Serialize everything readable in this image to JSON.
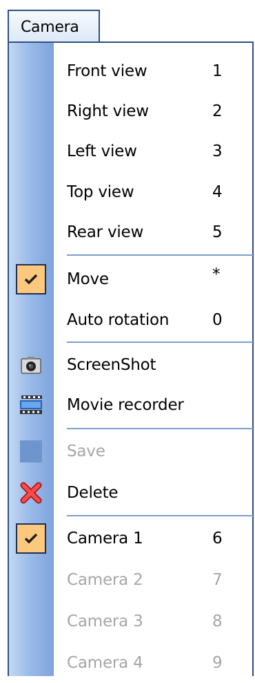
{
  "menubar": {
    "title": "Camera"
  },
  "menu": {
    "views": [
      {
        "label": "Front view",
        "shortcut": "1"
      },
      {
        "label": "Right view",
        "shortcut": "2"
      },
      {
        "label": "Left view",
        "shortcut": "3"
      },
      {
        "label": "Top view",
        "shortcut": "4"
      },
      {
        "label": "Rear view",
        "shortcut": "5"
      }
    ],
    "motion": [
      {
        "label": "Move",
        "shortcut": "*",
        "checked": true
      },
      {
        "label": "Auto rotation",
        "shortcut": "0",
        "checked": false
      }
    ],
    "capture": [
      {
        "label": "ScreenShot",
        "icon": "camera-icon"
      },
      {
        "label": "Movie recorder",
        "icon": "film-icon"
      }
    ],
    "file": [
      {
        "label": "Save",
        "icon": "save-icon",
        "disabled": true
      },
      {
        "label": "Delete",
        "icon": "delete-icon",
        "disabled": false
      }
    ],
    "cameras": [
      {
        "label": "Camera 1",
        "shortcut": "6",
        "checked": true,
        "disabled": false
      },
      {
        "label": "Camera 2",
        "shortcut": "7",
        "checked": false,
        "disabled": true
      },
      {
        "label": "Camera 3",
        "shortcut": "8",
        "checked": false,
        "disabled": true
      },
      {
        "label": "Camera 4",
        "shortcut": "9",
        "checked": false,
        "disabled": true
      }
    ]
  },
  "colors": {
    "highlight_check": "#fbc87d",
    "strip": "#9bbbe9",
    "separator": "#7d9ccd",
    "disabled_text": "#a6a6a6",
    "border": "#2b4f86"
  }
}
